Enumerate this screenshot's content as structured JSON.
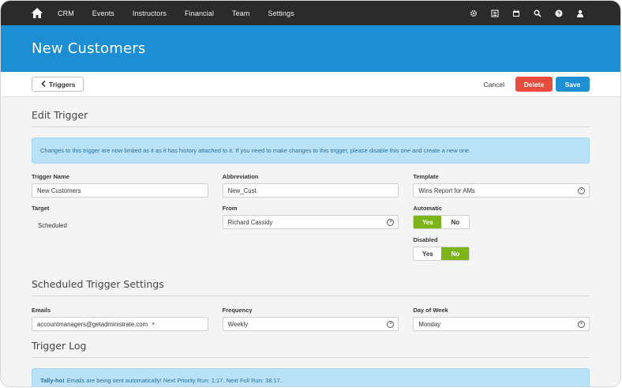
{
  "nav": {
    "items": [
      "CRM",
      "Events",
      "Instructors",
      "Financial",
      "Team",
      "Settings"
    ],
    "icons": [
      "gear-icon",
      "list-icon",
      "calendar-icon",
      "search-icon",
      "help-icon",
      "user-icon"
    ]
  },
  "header": {
    "title": "New Customers"
  },
  "actions": {
    "back_label": "Triggers",
    "cancel_label": "Cancel",
    "delete_label": "Delete",
    "save_label": "Save"
  },
  "edit": {
    "title": "Edit Trigger",
    "notice": "Changes to this trigger are now limited as it as it has history attached to it. If you need to make changes to this trigger, please disable this one and create a new one.",
    "trigger_name": {
      "label": "Trigger Name",
      "value": "New Customers"
    },
    "abbreviation": {
      "label": "Abbreviation",
      "value": "New_Cust"
    },
    "template": {
      "label": "Template",
      "value": "Wins Report for AMs"
    },
    "target": {
      "label": "Target",
      "value": "Scheduled"
    },
    "from": {
      "label": "From",
      "value": "Richard Cassidy"
    },
    "automatic": {
      "label": "Automatic",
      "yes": "Yes",
      "no": "No",
      "selected": "Yes"
    },
    "disabled": {
      "label": "Disabled",
      "yes": "Yes",
      "no": "No",
      "selected": "No"
    }
  },
  "scheduled": {
    "title": "Scheduled Trigger Settings",
    "emails": {
      "label": "Emails",
      "tag": "accountmanagers@getadministrate.com",
      "remove": "×"
    },
    "frequency": {
      "label": "Frequency",
      "value": "Weekly"
    },
    "day_of_week": {
      "label": "Day of Week",
      "value": "Monday"
    }
  },
  "log": {
    "title": "Trigger Log",
    "lead": "Tally-ho!",
    "message": "Emails are being sent automatically! Next Priority Run: 1:17. Next Full Run: 38:17."
  },
  "colors": {
    "nav_bg": "#2b2b2b",
    "header_bg": "#1b8ed4",
    "delete": "#e74c3c",
    "save": "#1e90d6",
    "toggle_on": "#7cb518",
    "alert_bg": "#b9e2f7"
  }
}
